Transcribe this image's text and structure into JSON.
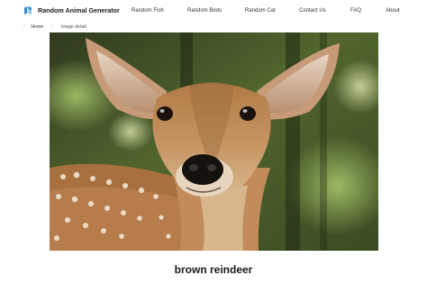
{
  "brand": {
    "name": "Random Animal Generator",
    "logo_icon": "blue-two-tone-logo-icon",
    "logo_color": "#2f8fd6"
  },
  "nav": {
    "items": [
      {
        "label": "Random Fish"
      },
      {
        "label": "Random Birds"
      },
      {
        "label": "Random Cat"
      },
      {
        "label": "Contact Us"
      },
      {
        "label": "FAQ"
      },
      {
        "label": "About"
      }
    ]
  },
  "breadcrumb": {
    "home": "Home",
    "current": "image detail",
    "separator": "/"
  },
  "image": {
    "subject": "deer-photo"
  },
  "caption": "brown reindeer"
}
